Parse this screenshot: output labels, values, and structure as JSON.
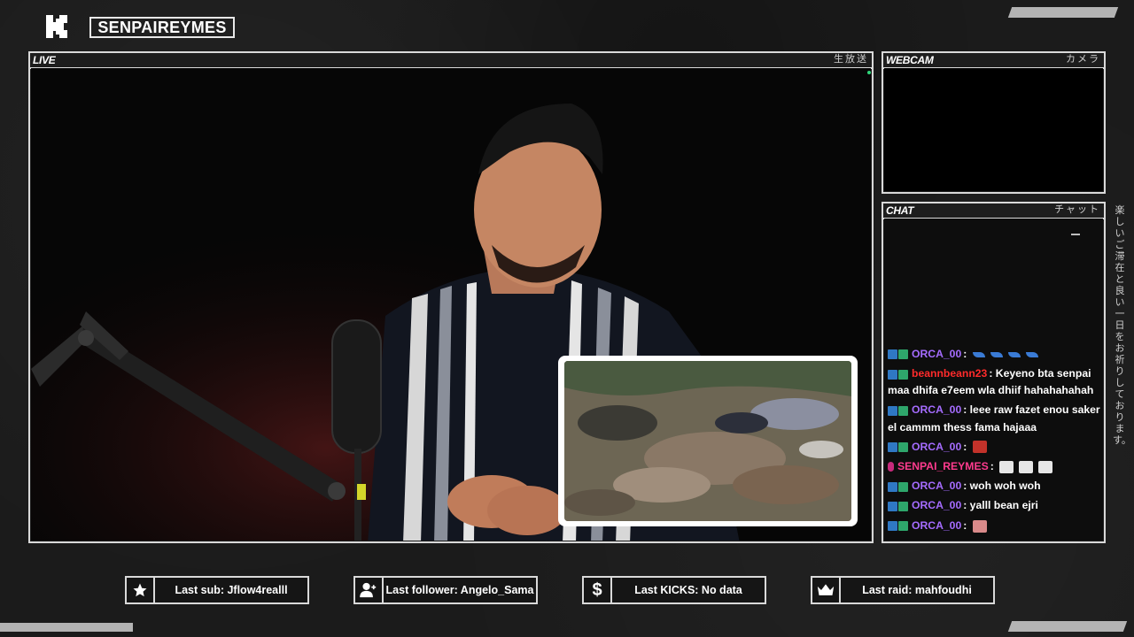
{
  "header": {
    "channel_name": "SENPAIREYMES",
    "logo_icon": "kick-logo-icon"
  },
  "live_panel": {
    "label": "LIVE",
    "jp_label": "生放送"
  },
  "webcam_panel": {
    "label": "WEBCAM",
    "jp_label": "カメラ"
  },
  "chat_panel": {
    "label": "CHAT",
    "jp_label": "チャット",
    "messages": [
      {
        "user": "ORCA_00",
        "color": "#a56cff",
        "text": "",
        "emotes": 4,
        "emote_type": "wave"
      },
      {
        "user": "beannbeann23",
        "color": "#ff2b2b",
        "text": "Keyeno bta senpai maa dhifa e7eem wla dhiif hahahahahah"
      },
      {
        "user": "ORCA_00",
        "color": "#a56cff",
        "text": "leee raw fazet enou saker el cammm thess fama hajaaa"
      },
      {
        "user": "ORCA_00",
        "color": "#a56cff",
        "text": "",
        "emotes": 1,
        "emote_type": "red"
      },
      {
        "user": "SENPAI_REYMES",
        "color": "#ff3b8e",
        "text": "",
        "emotes": 3,
        "emote_type": "white"
      },
      {
        "user": "ORCA_00",
        "color": "#a56cff",
        "text": "woh woh woh"
      },
      {
        "user": "ORCA_00",
        "color": "#a56cff",
        "text": "yalll bean ejri"
      },
      {
        "user": "ORCA_00",
        "color": "#a56cff",
        "text": "",
        "emotes": 1,
        "emote_type": "pink"
      }
    ]
  },
  "side_text": "楽しいご滞在と良い一日をお祈りしております。",
  "footer": {
    "last_sub": "Last sub: Jflow4realll",
    "last_follower": "Last follower: Angelo_Sama",
    "last_kicks": "Last KICKS: No data",
    "last_raid": "Last raid: mahfoudhi"
  }
}
